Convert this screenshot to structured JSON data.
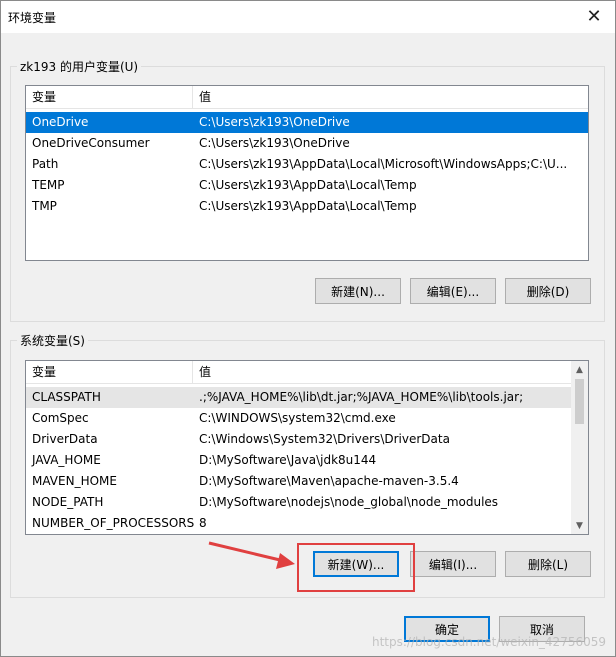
{
  "window": {
    "title": "环境变量",
    "close_glyph": "✕"
  },
  "user_vars": {
    "label": "zk193 的用户变量(U)",
    "col_var": "变量",
    "col_val": "值",
    "rows": [
      {
        "name": "OneDrive",
        "value": "C:\\Users\\zk193\\OneDrive",
        "selected": true
      },
      {
        "name": "OneDriveConsumer",
        "value": "C:\\Users\\zk193\\OneDrive"
      },
      {
        "name": "Path",
        "value": "C:\\Users\\zk193\\AppData\\Local\\Microsoft\\WindowsApps;C:\\U..."
      },
      {
        "name": "TEMP",
        "value": "C:\\Users\\zk193\\AppData\\Local\\Temp"
      },
      {
        "name": "TMP",
        "value": "C:\\Users\\zk193\\AppData\\Local\\Temp"
      }
    ],
    "buttons": {
      "new": "新建(N)...",
      "edit": "编辑(E)...",
      "delete": "删除(D)"
    }
  },
  "system_vars": {
    "label": "系统变量(S)",
    "col_var": "变量",
    "col_val": "值",
    "rows": [
      {
        "name": "CLASSPATH",
        "value": ".;%JAVA_HOME%\\lib\\dt.jar;%JAVA_HOME%\\lib\\tools.jar;",
        "hover": true
      },
      {
        "name": "ComSpec",
        "value": "C:\\WINDOWS\\system32\\cmd.exe"
      },
      {
        "name": "DriverData",
        "value": "C:\\Windows\\System32\\Drivers\\DriverData"
      },
      {
        "name": "JAVA_HOME",
        "value": "D:\\MySoftware\\Java\\jdk8u144"
      },
      {
        "name": "MAVEN_HOME",
        "value": "D:\\MySoftware\\Maven\\apache-maven-3.5.4"
      },
      {
        "name": "NODE_PATH",
        "value": "D:\\MySoftware\\nodejs\\node_global\\node_modules"
      },
      {
        "name": "NUMBER_OF_PROCESSORS",
        "value": "8"
      }
    ],
    "buttons": {
      "new": "新建(W)...",
      "edit": "编辑(I)...",
      "delete": "删除(L)"
    }
  },
  "dialog_buttons": {
    "ok": "确定",
    "cancel": "取消"
  },
  "watermark": "https://blog.csdn.net/weixin_42756059",
  "colors": {
    "selection": "#0078d7",
    "annotation": "#e04040"
  }
}
